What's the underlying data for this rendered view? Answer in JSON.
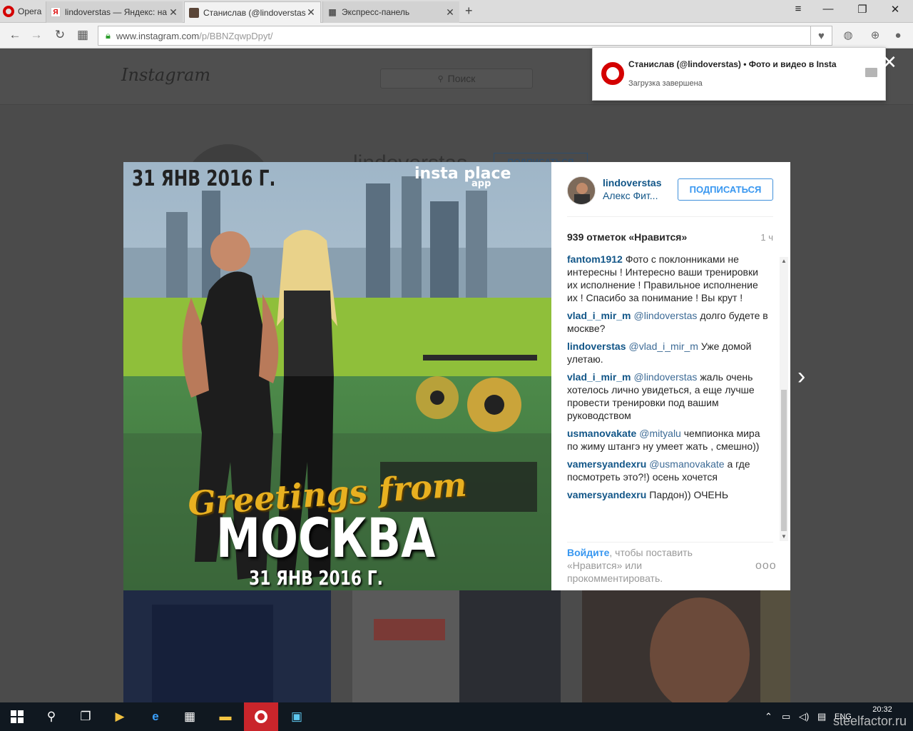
{
  "browser": {
    "menu_label": "Opera",
    "tabs": [
      {
        "favicon": "yandex-icon",
        "title": "lindoverstas — Яндекс: на",
        "active": false
      },
      {
        "favicon": "instagram-icon",
        "title": "Станислав (@lindoverstas",
        "active": true
      },
      {
        "favicon": "speed-dial-icon",
        "title": "Экспресс-панель",
        "active": false
      }
    ],
    "url_host": "www.instagram.com",
    "url_path": "/p/BBNZqwpDpyt/"
  },
  "download_popup": {
    "title": "Станислав (@lindoverstas) • Фото и видео в Instagram",
    "status": "Загрузка завершена"
  },
  "instagram": {
    "logo": "Instagram",
    "search_placeholder": "Поиск",
    "profile_name": "lindoverstas",
    "profile_follow": "ПОДПИСАТЬСЯ"
  },
  "post": {
    "photo_text": {
      "date_top": "31 ЯНВ 2016 Г.",
      "brand": "insta place",
      "brand_sub": "app",
      "greetings": "Greetings from",
      "city": "МОСКВА",
      "date_bottom": "31 ЯНВ 2016 Г."
    },
    "username": "lindoverstas",
    "location": "Алекс Фит...",
    "follow_label": "ПОДПИСАТЬСЯ",
    "likes": "939 отметок «Нравится»",
    "time_ago": "1 ч",
    "comments": [
      {
        "user": "fantom1912",
        "mention": "",
        "text": "Фото с поклонниками не интересны ! Интересно ваши тренировки их исполнение ! Правильное исполнение их ! Спасибо за понимание ! Вы крут !"
      },
      {
        "user": "vlad_i_mir_m",
        "mention": "@lindoverstas",
        "text": "долго будете в москве?"
      },
      {
        "user": "lindoverstas",
        "mention": "@vlad_i_mir_m",
        "text": "Уже домой улетаю."
      },
      {
        "user": "vlad_i_mir_m",
        "mention": "@lindoverstas",
        "text": "жаль очень хотелось лично увидеться, а еще лучше провести тренировки под вашим руководством"
      },
      {
        "user": "usmanovakate",
        "mention": "@mityalu",
        "text": "чемпионка мира по жиму штангэ ну умеет жать , смешно))"
      },
      {
        "user": "vamersyandexru",
        "mention": "@usmanovakate",
        "text": "а где посмотреть это?!) осень хочется"
      },
      {
        "user": "vamersyandexru",
        "mention": "",
        "text": "Пардон)) ОЧЕНЬ"
      }
    ],
    "login_link": "Войдите",
    "login_text": ", чтобы поставить «Нравится» или прокомментировать.",
    "more": "ооо"
  },
  "taskbar": {
    "lang": "ENG",
    "time": "20:32"
  },
  "watermark": "steelfactor.ru",
  "colors": {
    "accent": "#3897f0",
    "link": "#125688",
    "opera_red": "#d40000"
  }
}
